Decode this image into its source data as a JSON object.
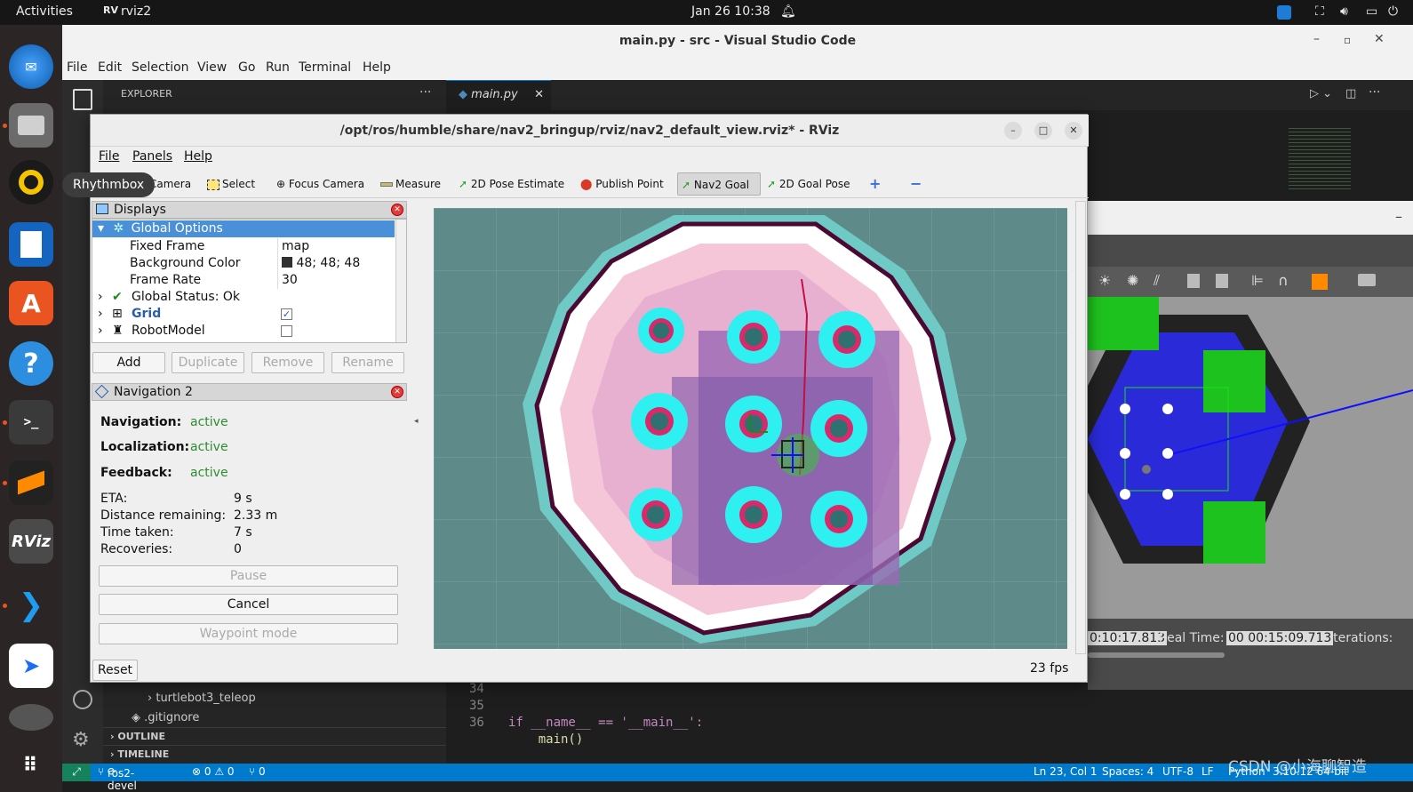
{
  "topbar": {
    "activities": "Activities",
    "app": "rviz2",
    "datetime": "Jan 26  10:38"
  },
  "dock": {
    "tooltip": "Rhythmbox",
    "rviz_label": "RViz"
  },
  "vscode": {
    "title": "main.py - src - Visual Studio Code",
    "menu": [
      "File",
      "Edit",
      "Selection",
      "View",
      "Go",
      "Run",
      "Terminal",
      "Help"
    ],
    "explorer_label": "EXPLORER",
    "tab": "main.py",
    "tree": [
      "turtlebot3_teleop",
      ".gitignore"
    ],
    "sections": [
      "OUTLINE",
      "TIMELINE"
    ],
    "code": [
      {
        "ln": "34",
        "text": "if __name__ == '__main__':"
      },
      {
        "ln": "35",
        "text": "    main()"
      },
      {
        "ln": "36",
        "text": ""
      }
    ],
    "status": {
      "branch": "ros2-devel",
      "problems": "⊗ 0 ⚠ 0",
      "ports": "⑂ 0",
      "position": "Ln 23, Col 1",
      "spaces": "Spaces: 4",
      "encoding": "UTF-8",
      "eol": "LF",
      "lang": "Python",
      "version": "3.10.12 64-bit"
    }
  },
  "gazebo": {
    "sim_time": "0:10:17.813",
    "real_label": "Real Time:",
    "real_time": "00 00:15:09.713",
    "iter_label": "Iterations:"
  },
  "rviz": {
    "title": "/opt/ros/humble/share/nav2_bringup/rviz/nav2_default_view.rviz* - RViz",
    "menu": [
      "File",
      "Panels",
      "Help"
    ],
    "tools": [
      "Camera",
      "Select",
      "Focus Camera",
      "Measure",
      "2D Pose Estimate",
      "Publish Point",
      "Nav2 Goal",
      "2D Goal Pose"
    ],
    "displays": {
      "header": "Displays",
      "global_options": "Global Options",
      "props": [
        {
          "k": "Fixed Frame",
          "v": "map"
        },
        {
          "k": "Background Color",
          "v": "48; 48; 48"
        },
        {
          "k": "Frame Rate",
          "v": "30"
        }
      ],
      "global_status": "Global Status: Ok",
      "grid": "Grid",
      "robot_model": "RobotModel",
      "buttons": [
        "Add",
        "Duplicate",
        "Remove",
        "Rename"
      ]
    },
    "nav": {
      "header": "Navigation 2",
      "navigation_label": "Navigation:",
      "navigation": "active",
      "localization_label": "Localization:",
      "localization": "active",
      "feedback_label": "Feedback:",
      "feedback": "active",
      "eta_label": "ETA:",
      "eta": "9 s",
      "dist_label": "Distance remaining:",
      "dist": "2.33 m",
      "time_label": "Time taken:",
      "time": "7 s",
      "rec_label": "Recoveries:",
      "rec": "0",
      "pause": "Pause",
      "cancel": "Cancel",
      "waypoint": "Waypoint mode"
    },
    "reset": "Reset",
    "fps": "23 fps"
  },
  "watermark": "CSDN @小海聊智造",
  "colors": {
    "accent": "#007acc",
    "selection": "#4a90d9",
    "active_green": "#2e8b2e"
  }
}
